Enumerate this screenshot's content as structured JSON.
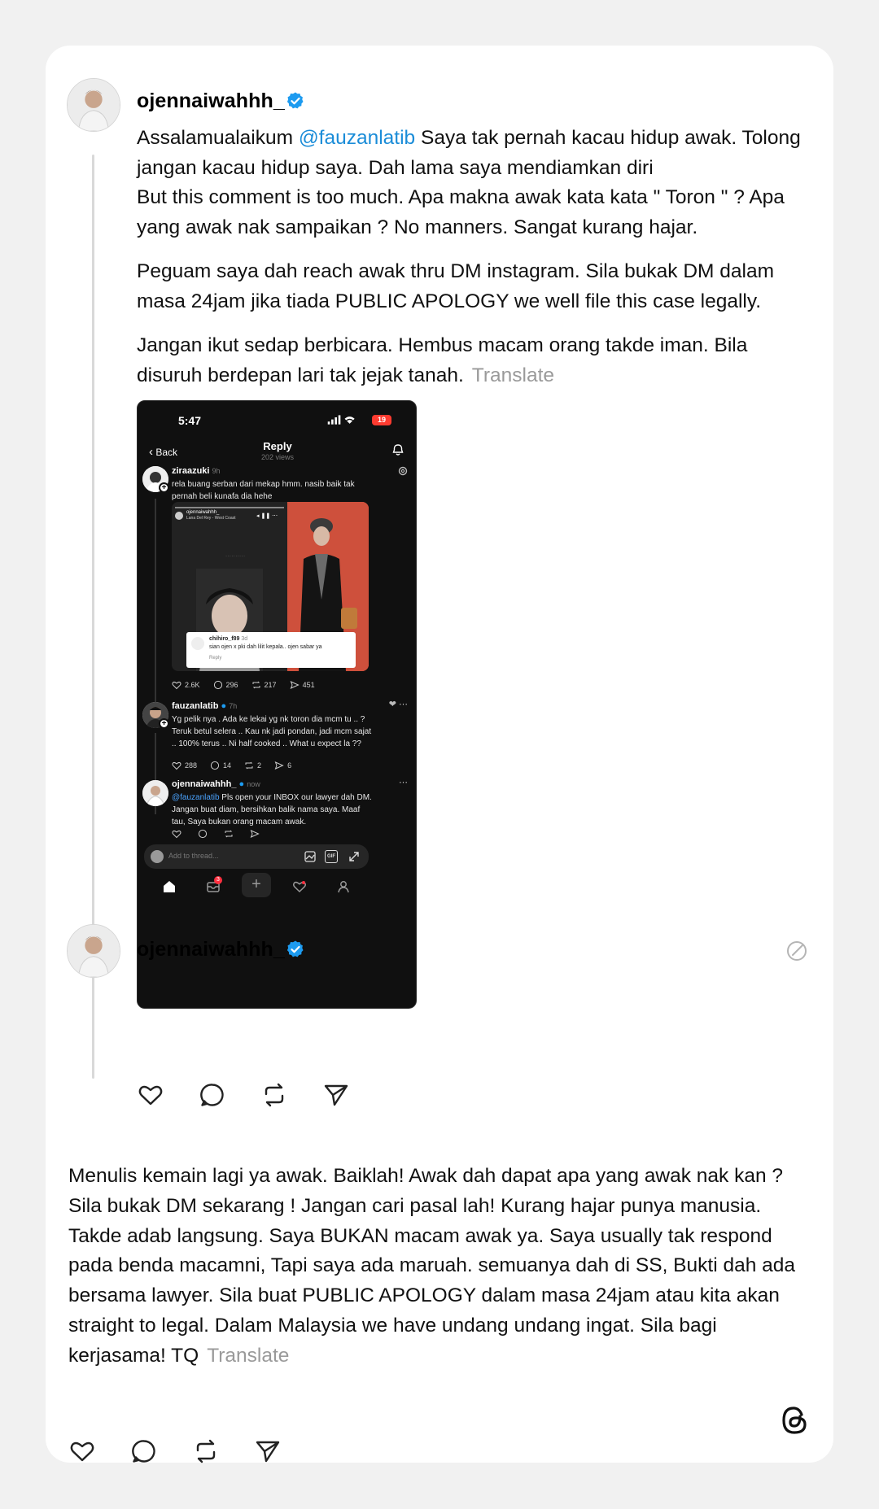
{
  "post1": {
    "username": "ojennaiwahhh_",
    "verified_color": "#1d9bf0",
    "p1_pre": "Assalamualaikum ",
    "p1_mention": "@fauzanlatib",
    "p1_post": " Saya tak pernah kacau hidup awak. Tolong jangan kacau hidup saya. Dah lama saya mendiamkan diri",
    "p2": "But this comment is too much. Apa makna awak kata kata \" Toron \" ? Apa yang awak nak sampaikan ? No manners. Sangat kurang hajar.",
    "p3": "Peguam saya dah reach awak thru DM instagram. Sila bukak DM dalam masa 24jam jika tiada PUBLIC APOLOGY we well file this case legally.",
    "p4": "Jangan ikut sedap berbicara. Hembus macam orang takde iman. Bila disuruh berdepan lari tak jejak tanah.",
    "translate": "Translate",
    "actions": [
      "like-icon",
      "comment-icon",
      "repost-icon",
      "share-icon"
    ]
  },
  "screenshot": {
    "time": "5:47",
    "battery": "19",
    "back": "Back",
    "title": "Reply",
    "views": "202 views",
    "c1": {
      "name": "ziraazuki",
      "time": "9h",
      "text": "rela buang serban dari mekap hmm. nasib baik tak pernah beli kunafa dia hehe",
      "media_user": "ojennaiwahhh_",
      "media_song": "Lana Del Rey - West Coast",
      "media_comment_user": "chihiro_f89",
      "media_comment_time": "3d",
      "media_comment_text": "sian ojen x pki dah lilit kepala.. ojen sabar ya",
      "media_comment_reply": "Reply",
      "likes": "2.6K",
      "comments": "296",
      "reposts": "217",
      "shares": "451"
    },
    "c2": {
      "name": "fauzanlatib",
      "time": "7h",
      "text": "Yg pelik nya . Ada ke lekai yg nk toron dia mcm tu .. ? Teruk betul selera .. Kau nk jadi pondan, jadi mcm sajat .. 100% terus .. Ni half cooked .. What u expect la ??",
      "likes": "288",
      "comments": "14",
      "reposts": "2",
      "shares": "6"
    },
    "c3": {
      "name": "ojennaiwahhh_",
      "time": "now",
      "mention": "@fauzanlatib",
      "text": " Pls open your INBOX our lawyer dah DM. Jangan buat diam, bersihkan balik nama saya. Maaf tau, Saya bukan orang macam awak."
    },
    "input_placeholder": "Add to thread...",
    "gif_label": "GIF",
    "inbox_badge": "3"
  },
  "post2": {
    "username": "ojennaiwahhh_",
    "text": "Menulis kemain lagi ya awak. Baiklah! Awak dah dapat apa yang awak nak kan ? Sila bukak DM sekarang ! Jangan cari pasal lah! Kurang hajar punya manusia. Takde adab langsung. Saya BUKAN macam awak ya. Saya usually tak respond pada benda macamni, Tapi saya ada maruah. semuanya dah di SS, Bukti dah ada bersama lawyer. Sila buat PUBLIC APOLOGY dalam masa 24jam atau kita akan straight to legal. Dalam Malaysia we have undang undang ingat. Sila bagi kerjasama! TQ",
    "translate": "Translate"
  },
  "footer": {
    "logo": "threads-logo-icon"
  }
}
